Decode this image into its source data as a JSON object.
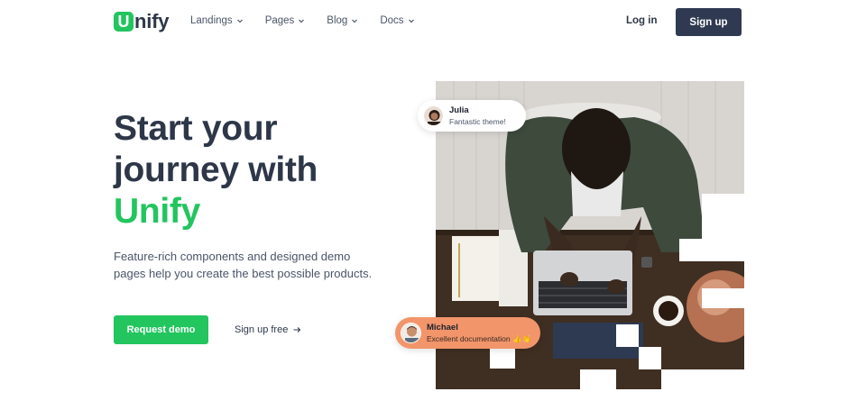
{
  "brand": {
    "logo_letter": "U",
    "name": "nify",
    "accent_color": "#22c55e",
    "dark_color": "#2f3a52"
  },
  "nav": {
    "items": [
      {
        "label": "Landings"
      },
      {
        "label": "Pages"
      },
      {
        "label": "Blog"
      },
      {
        "label": "Docs"
      }
    ],
    "login_label": "Log in",
    "signup_label": "Sign up"
  },
  "hero": {
    "title_line1": "Start your",
    "title_line2": "journey with",
    "title_accent": "Unify",
    "description": "Feature-rich components and designed demo pages help you create the best possible products.",
    "primary_cta": "Request demo",
    "secondary_cta": "Sign up free",
    "secondary_cta_icon": "arrow-right-icon"
  },
  "testimonials": [
    {
      "name": "Julia",
      "message": "Fantastic theme!",
      "background": "#ffffff"
    },
    {
      "name": "Michael",
      "message": "Excellent documentation 👍👏",
      "background": "#f2956b"
    }
  ]
}
